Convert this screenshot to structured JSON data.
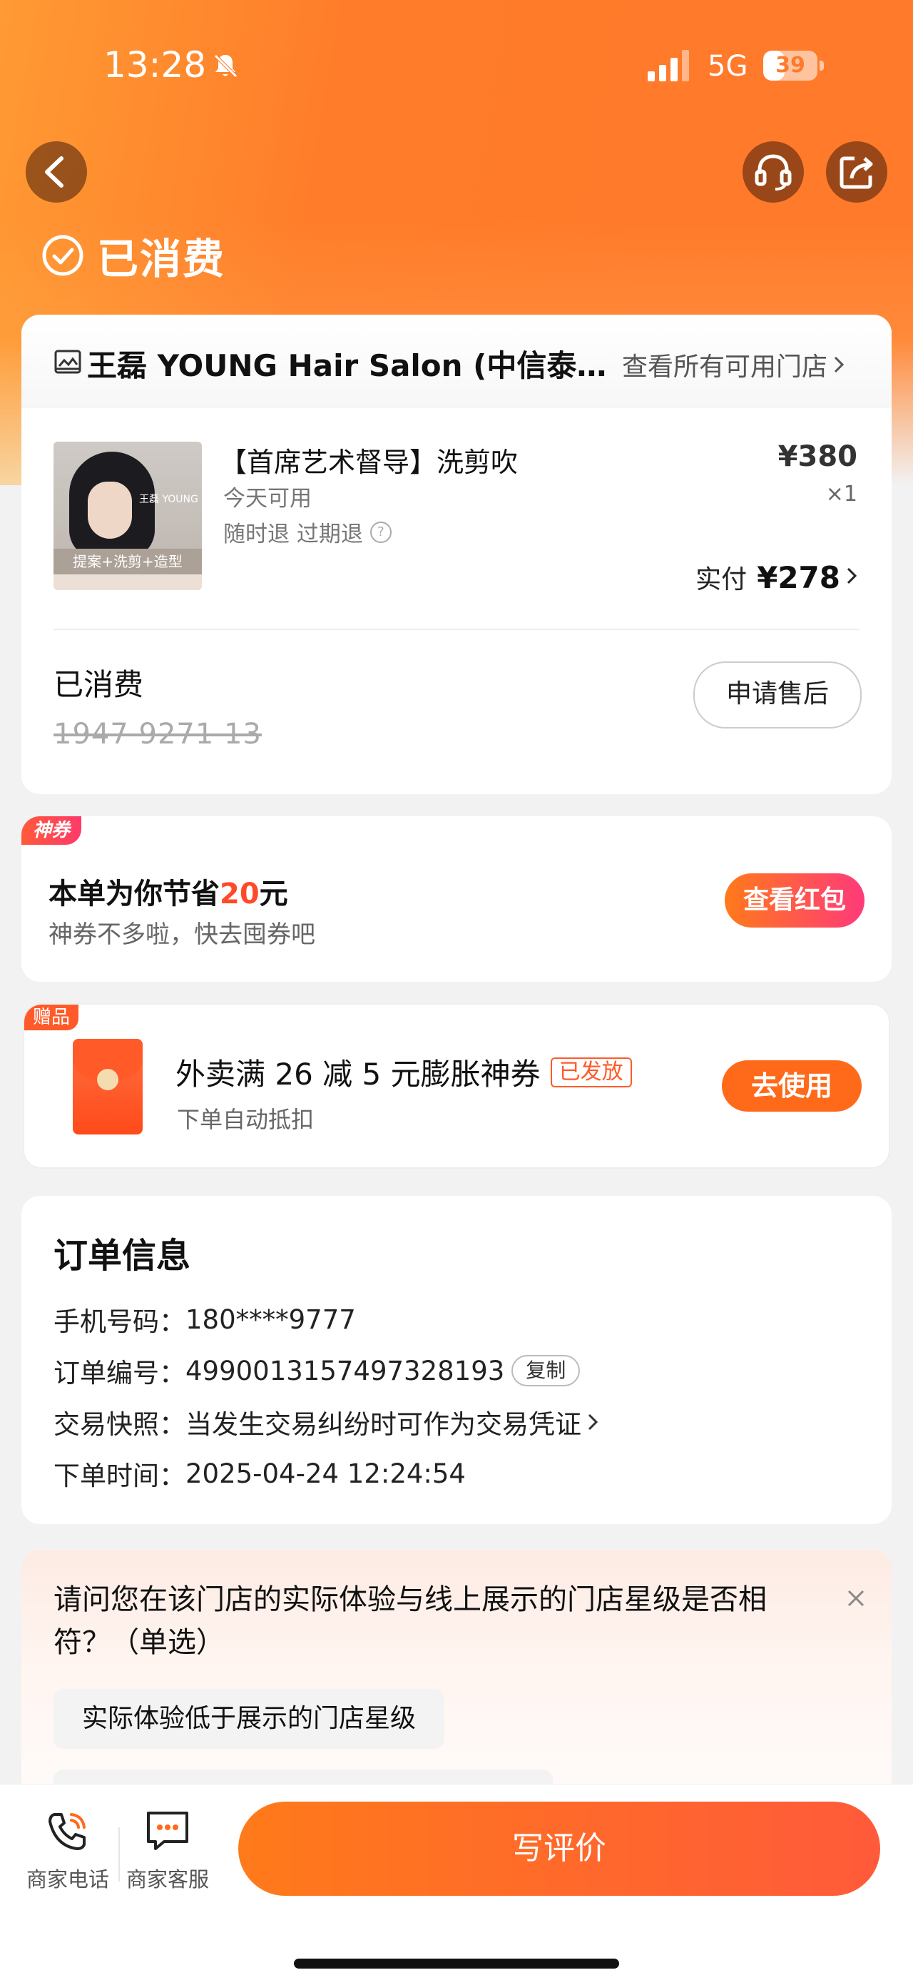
{
  "status_bar": {
    "time": "13:28",
    "network": "5G",
    "battery": "39",
    "battery_level": 0.39
  },
  "header": {
    "order_status": "已消费"
  },
  "store": {
    "name": "王磊 YOUNG  Hair Salon (中信泰富...",
    "all_stores_link": "查看所有可用门店"
  },
  "product": {
    "title": "【首席艺术督导】洗剪吹",
    "availability": "今天可用",
    "refund_policy": "随时退 过期退",
    "price": "¥380",
    "quantity": "×1",
    "paid_label": "实付",
    "paid_amount": "¥278",
    "thumb_caption": "提案+洗剪+造型",
    "thumb_brand": "王磊 YOUNG"
  },
  "voucher": {
    "status": "已消费",
    "code": "1947 9271 13",
    "after_sale_button": "申请售后"
  },
  "coupon": {
    "tag": "神券",
    "saving_prefix": "本单为你节省",
    "saving_amount": "20",
    "saving_suffix": "元",
    "subtitle": "神券不多啦，快去囤券吧",
    "button": "查看红包"
  },
  "gift": {
    "tag": "赠品",
    "title": "外卖满 26 减 5 元膨胀神券",
    "badge": "已发放",
    "subtitle": "下单自动抵扣",
    "button": "去使用"
  },
  "order_info": {
    "title": "订单信息",
    "phone_label": "手机号码：",
    "phone": "180****9777",
    "order_no_label": "订单编号：",
    "order_no": "4990013157497328193",
    "copy_button": "复制",
    "snapshot_label": "交易快照：",
    "snapshot_text": "当发生交易纠纷时可作为交易凭证",
    "time_label": "下单时间：",
    "time": "2025-04-24 12:24:54"
  },
  "survey": {
    "question": "请问您在该门店的实际体验与线上展示的门店星级是否相符？（单选）",
    "options": [
      "实际体验低于展示的门店星级"
    ]
  },
  "bottom_bar": {
    "phone_label": "商家电话",
    "service_label": "商家客服",
    "review_button": "写评价"
  },
  "colors": {
    "accent": "#ff7a1a",
    "highlight": "#ff4a2a"
  }
}
